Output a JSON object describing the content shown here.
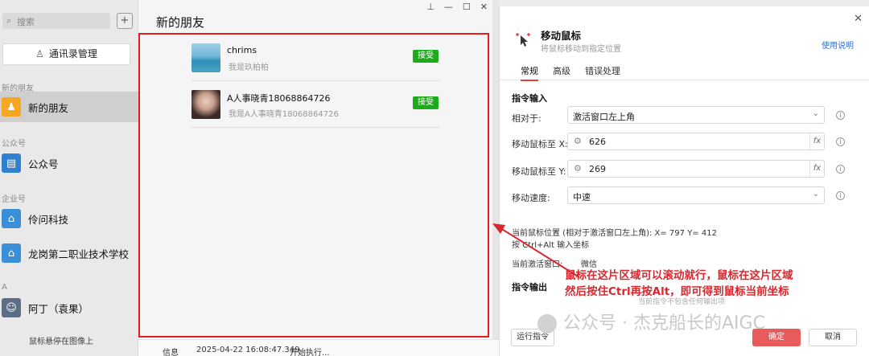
{
  "sidebar": {
    "search_placeholder": "搜索",
    "add_symbol": "+",
    "contacts_button": "通讯录管理",
    "sections": {
      "new_friends": "新的朋友",
      "official": "公众号",
      "enterprise": "企业号",
      "letter_a": "A"
    },
    "items": [
      {
        "label": "新的朋友",
        "color": "#f5a623"
      },
      {
        "label": "公众号",
        "color": "#2f80d1"
      },
      {
        "label": "伶问科技",
        "color": "#3a8fd8"
      },
      {
        "label": "龙岗第二职业技术学校",
        "color": "#3a8fd8"
      },
      {
        "label": "阿丁（袁果）",
        "color": "#5d6d86"
      }
    ],
    "bottom_hint": "鼠标悬停在图像上"
  },
  "main": {
    "title": "新的朋友",
    "friends": [
      {
        "name": "chrims",
        "message": "我是玖柏柏",
        "accept": "接受"
      },
      {
        "name": "A人事晓青18068864726",
        "message": "我是A人事晓青18068864726",
        "accept": "接受"
      }
    ]
  },
  "log": {
    "level": "信息",
    "time": "2025-04-22 16:08:47.349",
    "message": "开始执行..."
  },
  "dialog": {
    "title": "移动鼠标",
    "subtitle": "将鼠标移动到指定位置",
    "help": "使用说明",
    "tabs": [
      "常规",
      "高级",
      "错误处理"
    ],
    "section_input": "指令输入",
    "relative_label": "相对于:",
    "relative_value": "激活窗口左上角",
    "x_label": "移动鼠标至  X:",
    "x_value": "626",
    "y_label": "移动鼠标至  Y:",
    "y_value": "269",
    "speed_label": "移动速度:",
    "speed_value": "中速",
    "fx": "fx",
    "mouse_pos": "当前鼠标位置 (相对于激活窗口左上角): X= 797 Y= 412",
    "hint": "按 Ctrl+Alt 输入坐标",
    "active_window_label": "当前激活窗口:",
    "active_window_value": "微信",
    "section_output": "指令输出",
    "output_note": "当前指令不包含任何输出项",
    "btn_run": "运行指令",
    "btn_ok": "确定",
    "btn_cancel": "取消"
  },
  "annotation": {
    "line1": "鼠标在这片区域可以滚动就行，鼠标在这片区域",
    "line2": "然后按住Ctrl再按Alt，即可得到鼠标当前坐标"
  },
  "watermark": "公众号 · 杰克船长的AIGC"
}
